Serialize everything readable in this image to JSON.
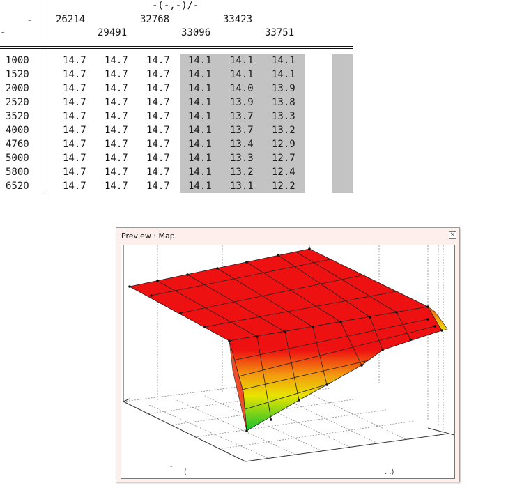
{
  "table": {
    "header": {
      "axis_label": "-(-,-)/-",
      "dash_left": "-",
      "dash_row": "-",
      "top_row": [
        "26214",
        "32768",
        "33423"
      ],
      "bottom_row": [
        "29491",
        "33096",
        "33751"
      ]
    },
    "rows": [
      {
        "rpm": "1000",
        "values": [
          "14.7",
          "14.7",
          "14.7",
          "14.1",
          "14.1",
          "14.1"
        ]
      },
      {
        "rpm": "1520",
        "values": [
          "14.7",
          "14.7",
          "14.7",
          "14.1",
          "14.1",
          "14.1"
        ]
      },
      {
        "rpm": "2000",
        "values": [
          "14.7",
          "14.7",
          "14.7",
          "14.1",
          "14.0",
          "13.9"
        ]
      },
      {
        "rpm": "2520",
        "values": [
          "14.7",
          "14.7",
          "14.7",
          "14.1",
          "13.9",
          "13.8"
        ]
      },
      {
        "rpm": "3520",
        "values": [
          "14.7",
          "14.7",
          "14.7",
          "14.1",
          "13.7",
          "13.3"
        ]
      },
      {
        "rpm": "4000",
        "values": [
          "14.7",
          "14.7",
          "14.7",
          "14.1",
          "13.7",
          "13.2"
        ]
      },
      {
        "rpm": "4760",
        "values": [
          "14.7",
          "14.7",
          "14.7",
          "14.1",
          "13.4",
          "12.9"
        ]
      },
      {
        "rpm": "5000",
        "values": [
          "14.7",
          "14.7",
          "14.7",
          "14.1",
          "13.3",
          "12.7"
        ]
      },
      {
        "rpm": "5800",
        "values": [
          "14.7",
          "14.7",
          "14.7",
          "14.1",
          "13.2",
          "12.4"
        ]
      },
      {
        "rpm": "6520",
        "values": [
          "14.7",
          "14.7",
          "14.7",
          "14.1",
          "13.1",
          "12.2"
        ]
      }
    ],
    "colors": {
      "highlight": "#c3c3c3",
      "text": "#1a1a1a"
    }
  },
  "preview": {
    "title": "Preview : Map",
    "close_icon": "close-icon",
    "axis_marks_left": "-",
    "axis_marks_mid": "(",
    "axis_marks_right": ". .)",
    "colors": {
      "high": "#ee1111",
      "mid": "#f0e000",
      "low": "#11c030"
    }
  }
}
